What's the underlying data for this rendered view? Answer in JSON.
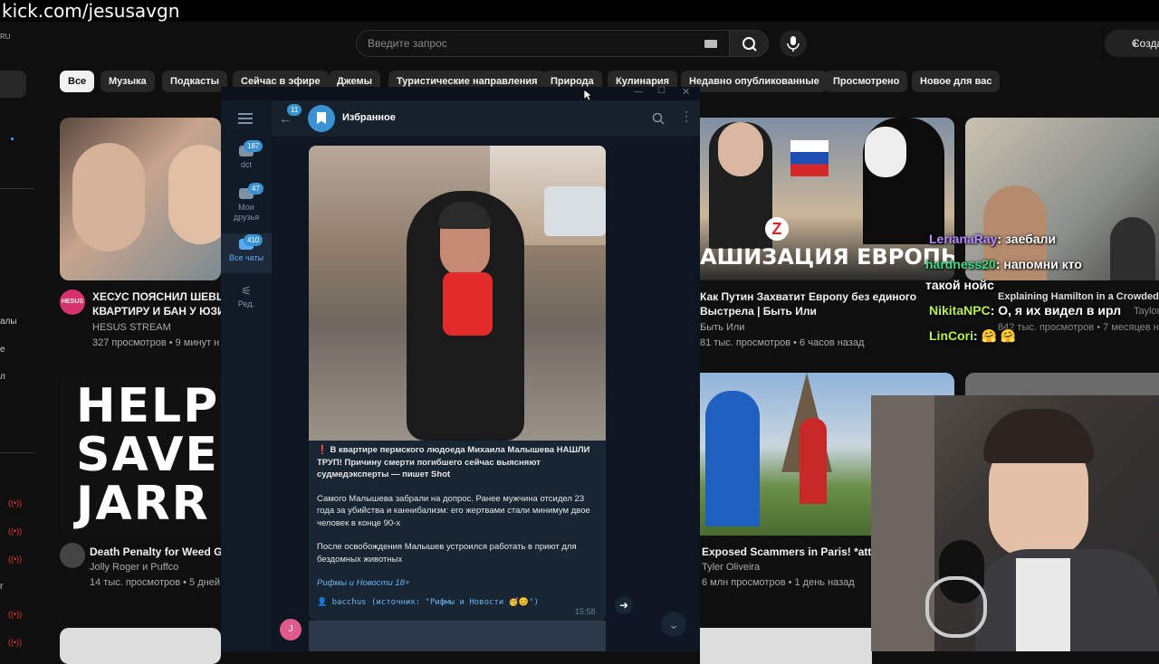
{
  "banner": {
    "text": "kick.com/jesusavgn"
  },
  "youtube": {
    "region": "RU",
    "search_placeholder": "Введите запрос",
    "create_label": "Созда",
    "chips": [
      "Все",
      "Музыка",
      "Подкасты",
      "Сейчас в эфире",
      "Джемы",
      "Туристические направления",
      "Природа",
      "Кулинария",
      "Недавно опубликованные",
      "Просмотрено",
      "Новое для вас"
    ],
    "left_nav": {
      "fragments": [
        "алы",
        "е",
        "л",
        "г"
      ]
    },
    "videos": [
      {
        "title": "ХЕСУС ПОЯСНИЛ ШЕВЦОВ",
        "title2": "КВАРТИРУ И БАН У ЮЗИ",
        "channel": "HESUS STREAM",
        "meta": "327 просмотров • 9 минут н",
        "avatar_text": "HESUS"
      },
      {
        "title": "Как Путин Захватит Европу без единого",
        "title2": "Выстрела | Быть Или",
        "channel": "Быть Или",
        "meta": "81 тыс. просмотров • 6 часов назад",
        "thumb_text": "АШИЗАЦИЯ ЕВРОПЫ",
        "thumb_badge": "Z"
      },
      {
        "title": "Explaining Hamilton in a Crowded",
        "channel": "Taylor",
        "meta": "842 тыс. просмотров • 7 месяцев на"
      },
      {
        "title": "Death Penalty for Weed Gu",
        "channel": "Jolly Roger и Puffco",
        "meta": "14 тыс. просмотров • 5 дней",
        "thumb_lines": [
          "HELP",
          "SAVE",
          "JARR"
        ]
      },
      {
        "title": "Exposed Scammers in Paris! *attac",
        "channel": "Tyler Oliveira",
        "meta": "6 млн просмотров • 1 день назад"
      }
    ]
  },
  "telegram": {
    "chat_title": "Избранное",
    "back_badge": "11",
    "rail": [
      {
        "label": "dct",
        "badge": "187"
      },
      {
        "label": "Мои друзья",
        "badge": "47"
      },
      {
        "label": "Все чаты",
        "badge": "410"
      },
      {
        "label": "Ред.",
        "badge": ""
      }
    ],
    "post": {
      "headline": "❗ В квартире пермского людоеда Михаила Малышева НАШЛИ ТРУП! Причину смерти погибшего сейчас выясняют судмедэксперты — пишет Shot",
      "para2": "Самого Малышева забрали на допрос. Ранее мужчина отсидел 23 года за убийства и каннибализм: его жертвами стали минимум двое человек в конце 90-х",
      "para3": "После освобождения Малышев устроился работать в приют для бездомных животных",
      "source_link": "Рифмы и Новости 18+",
      "forward": "👤 bacchus (источник: \"Рифмы и Новости 🥳😊\")",
      "time": "15:58"
    },
    "user_avatar_letter": "J"
  },
  "stream_chat": [
    {
      "user": "LerianaRay",
      "text": ": заебали",
      "color": "#b58bff"
    },
    {
      "user": "hardness20",
      "text": ": напомни кто",
      "color": "#3ddc84",
      "text2": "такой нойс"
    },
    {
      "user": "NikitaNPC",
      "text": ": О, я их видел в ирл",
      "color": "#b6f24a"
    },
    {
      "user": "LinCori",
      "text": ": 🤗 🤗",
      "color": "#b6f24a"
    }
  ],
  "colors": {
    "youtube_bg": "#0f0f0f",
    "telegram_bg": "#0e1621",
    "telegram_accent": "#3a92d3"
  }
}
